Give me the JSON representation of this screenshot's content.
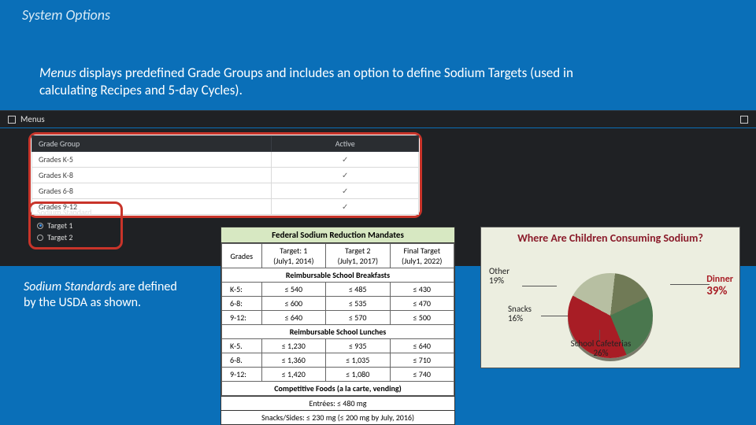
{
  "slide": {
    "title": "System Options",
    "intro_lead": "Menus",
    "intro_rest": " displays predefined Grade Groups and includes an option to define Sodium Targets (used in calculating Recipes and 5-day Cycles).",
    "caption_lead": "Sodium Standards",
    "caption_rest": " are defined by the USDA as shown."
  },
  "app": {
    "header_title": "Menus",
    "grade_table": {
      "col1": "Grade Group",
      "col2": "Active",
      "rows": [
        {
          "name": "Grades K-5",
          "active": "✓"
        },
        {
          "name": "Grades K-8",
          "active": "✓"
        },
        {
          "name": "Grades 6-8",
          "active": "✓"
        },
        {
          "name": "Grades 9-12",
          "active": "✓"
        }
      ]
    },
    "sodium": {
      "header": "Sodium Standard",
      "opt1": "Target 1",
      "opt2": "Target 2"
    }
  },
  "mandate": {
    "title": "Federal Sodium Reduction Mandates",
    "cols": {
      "c0": "Grades",
      "c1a": "Target: 1",
      "c1b": "(July1, 2014)",
      "c2a": "Target 2",
      "c2b": "(July1, 2017)",
      "c3a": "Final Target",
      "c3b": "(July1, 2022)"
    },
    "sec_breakfast": "Reimbursable School Breakfasts",
    "breakfast": [
      {
        "g": "K-5:",
        "t1": "≤ 540",
        "t2": "≤ 485",
        "t3": "≤ 430"
      },
      {
        "g": "6-8:",
        "t1": "≤ 600",
        "t2": "≤ 535",
        "t3": "≤ 470"
      },
      {
        "g": "9-12:",
        "t1": "≤ 640",
        "t2": "≤ 570",
        "t3": "≤ 500"
      }
    ],
    "sec_lunch": "Reimbursable School Lunches",
    "lunch": [
      {
        "g": "K-5.",
        "t1": "≤ 1,230",
        "t2": "≤ 935",
        "t3": "≤ 640"
      },
      {
        "g": "6-8.",
        "t1": "≤ 1,360",
        "t2": "≤ 1,035",
        "t3": "≤ 710"
      },
      {
        "g": "9-12:",
        "t1": "≤ 1,420",
        "t2": "≤ 1,080",
        "t3": "≤ 740"
      }
    ],
    "sec_comp": "Competitive Foods (a la carte, vending)",
    "footer1": "Entrées: ≤ 480 mg",
    "footer2": "Snacks/Sides: ≤ 230 mg (≤ 200 mg by July, 2016)"
  },
  "chart_data": {
    "type": "pie",
    "title": "Where Are Children Consuming Sodium?",
    "series": [
      {
        "name": "Dinner",
        "value": 39,
        "label": "Dinner",
        "pct": "39%",
        "color": "#a81d25",
        "exploded": true
      },
      {
        "name": "Other",
        "value": 19,
        "label": "Other",
        "pct": "19%",
        "color": "#b7bfa2"
      },
      {
        "name": "Snacks",
        "value": 16,
        "label": "Snacks",
        "pct": "16%",
        "color": "#707a56"
      },
      {
        "name": "School Cafeterias",
        "value": 26,
        "label": "School\nCafeterias",
        "pct": "26%",
        "color": "#4a774e"
      }
    ]
  }
}
